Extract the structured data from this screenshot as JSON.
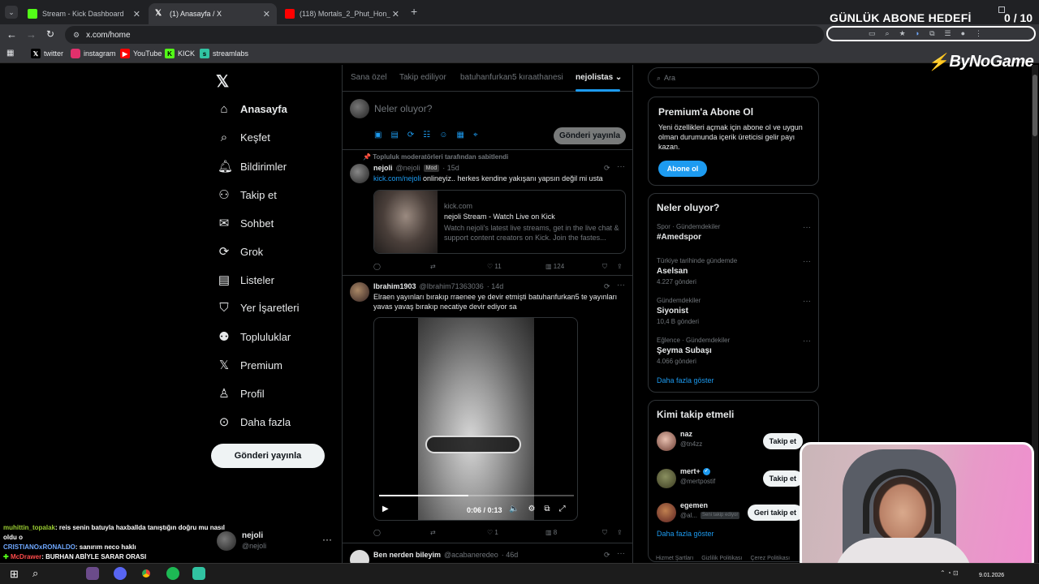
{
  "browser": {
    "tabs": [
      {
        "title": "Stream - Kick Dashboard",
        "favicon_color": "#53fc18",
        "active": false
      },
      {
        "title": "(1) Anasayfa / X",
        "favicon_color": "#ffffff",
        "active": true
      },
      {
        "title": "(118) Mortals_2_Phut_Hon_Funk",
        "favicon_color": "#ff0000",
        "active": false
      }
    ],
    "new_tab": "+",
    "url": "x.com/home",
    "bookmarks": [
      {
        "label": "twitter",
        "icon": "x-icon",
        "color": "#000000"
      },
      {
        "label": "instagram",
        "icon": "instagram-icon",
        "color": "#e1306c"
      },
      {
        "label": "YouTube",
        "icon": "youtube-icon",
        "color": "#ff0000"
      },
      {
        "label": "KICK",
        "icon": "kick-icon",
        "color": "#53fc18"
      },
      {
        "label": "streamlabs",
        "icon": "streamlabs-icon",
        "color": "#31c3a2"
      }
    ]
  },
  "overlay": {
    "goal_title": "GÜNLÜK ABONE HEDEFİ",
    "goal_count": "0",
    "goal_total": "/ 10",
    "sponsor_logo": "ByNoGame"
  },
  "nav": {
    "items": [
      {
        "label": "Anasayfa",
        "icon": "home-icon",
        "active": true
      },
      {
        "label": "Keşfet",
        "icon": "search-icon"
      },
      {
        "label": "Bildirimler",
        "icon": "bell-icon"
      },
      {
        "label": "Takip et",
        "icon": "person-add-icon"
      },
      {
        "label": "Sohbet",
        "icon": "mail-icon"
      },
      {
        "label": "Grok",
        "icon": "grok-icon"
      },
      {
        "label": "Listeler",
        "icon": "list-icon"
      },
      {
        "label": "Yer İşaretleri",
        "icon": "bookmark-icon"
      },
      {
        "label": "Topluluklar",
        "icon": "communities-icon"
      },
      {
        "label": "Premium",
        "icon": "x-icon"
      },
      {
        "label": "Profil",
        "icon": "profile-icon"
      },
      {
        "label": "Daha fazla",
        "icon": "more-circle-icon"
      }
    ],
    "post_button": "Gönderi yayınla",
    "profile": {
      "name": "nejoli",
      "handle": "@nejoli"
    }
  },
  "feed": {
    "tabs": [
      "Sana özel",
      "Takip ediliyor",
      "batuhanfurkan5 kıraathanesi",
      "nejolistas"
    ],
    "compose_placeholder": "Neler oluyor?",
    "compose_button": "Gönderi yayınla",
    "pinned_label": "Topluluk moderatörleri tarafından sabitlendi",
    "tweets": [
      {
        "name": "nejoli",
        "handle": "@nejoli",
        "badge": "Mod",
        "time": "· 15d",
        "link": "kick.com/nejoli",
        "text": " onlineyiz.. herkes kendine yakışanı yapsın değil mi usta",
        "card": {
          "domain": "kick.com",
          "title": "nejoli Stream - Watch Live on Kick",
          "desc": "Watch nejoli's latest live streams, get in the live chat & support content creators on Kick. Join the fastes..."
        },
        "likes": "11",
        "views": "124"
      },
      {
        "name": "Ibrahim1903",
        "handle": "@Ibrahim71363036",
        "time": "· 14d",
        "text": "Elraen yayınları bırakıp rraenee ye devir etmişti batuhanfurkan5 te yayınları yavas yavaş bırakıp necatiye devir ediyor sa",
        "video_time": "0:06 / 0:13",
        "video_progress": 0.46,
        "likes": "1",
        "views": "8"
      },
      {
        "name": "Ben nerden bileyim",
        "handle": "@acabaneredeo",
        "time": "· 46d"
      }
    ]
  },
  "sidebar": {
    "search_placeholder": "Ara",
    "premium": {
      "title": "Premium'a Abone Ol",
      "text": "Yeni özellikleri açmak için abone ol ve uygun olman durumunda içerik üreticisi gelir payı kazan.",
      "button": "Abone ol"
    },
    "trends": {
      "title": "Neler oluyor?",
      "items": [
        {
          "meta": "Spor · Gündemdekiler",
          "title": "#Amedspor",
          "count": ""
        },
        {
          "meta": "Türkiye tarihinde gündemde",
          "title": "Aselsan",
          "count": "4.227 gönderi"
        },
        {
          "meta": "Gündemdekiler",
          "title": "Siyonist",
          "count": "10,4 B gönderi"
        },
        {
          "meta": "Eğlence · Gündemdekiler",
          "title": "Şeyma Subaşı",
          "count": "4.066 gönderi"
        }
      ],
      "more": "Daha fazla göster"
    },
    "who_to_follow": {
      "title": "Kimi takip etmeli",
      "items": [
        {
          "name": "naz",
          "handle": "@tn4zz",
          "button": "Takip et"
        },
        {
          "name": "mert+",
          "handle": "@mertpostif",
          "button": "Takip et",
          "verified": true
        },
        {
          "name": "egemen",
          "handle": "@al...",
          "tag": "Seni takip ediyor",
          "button": "Geri takip et"
        }
      ],
      "more": "Daha fazla göster"
    },
    "footer": [
      "Hizmet Şartları",
      "Gizlilik Politikası",
      "Çerez Politikası"
    ]
  },
  "chat": {
    "messages": [
      {
        "user": "muhittin_topalak",
        "color": "#9acd32",
        "text": ": reis senin batuyla haxballda tanıştığın doğru mu nasıl oldu o"
      },
      {
        "user": "CRISTIANOxRONALDO",
        "color": "#6fa8ff",
        "text": ": sanırım neco haklı"
      },
      {
        "user": "McDrawer",
        "color": "#ff4b4b",
        "text": ": BURHAN ABİYLE SARAR ORASI"
      }
    ]
  },
  "taskbar": {
    "time": "9.01.2026"
  },
  "colors": {
    "accent": "#1d9bf0",
    "bg": "#000000",
    "border": "#2f3336"
  }
}
